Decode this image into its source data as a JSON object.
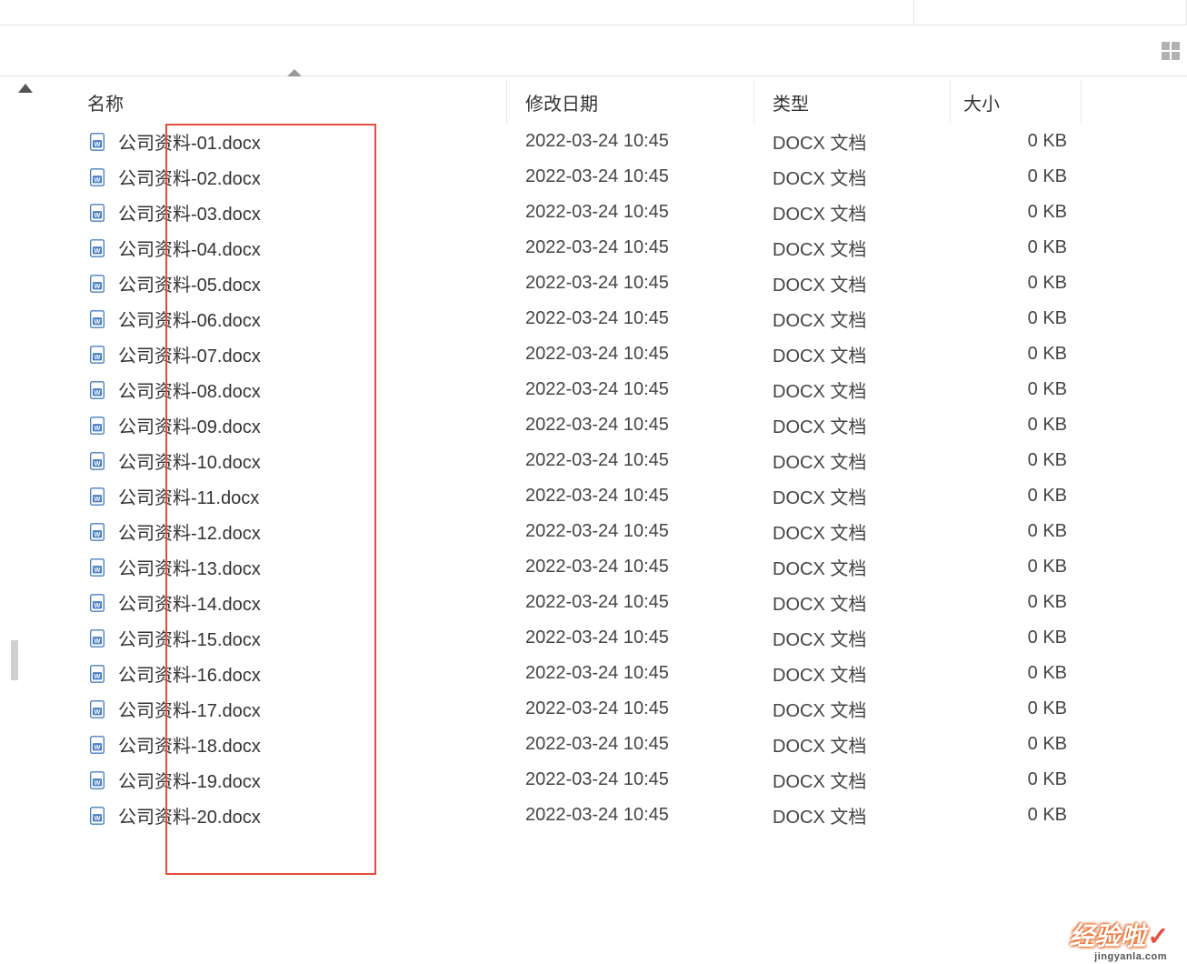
{
  "columns": {
    "name": "名称",
    "date": "修改日期",
    "type": "类型",
    "size": "大小"
  },
  "files": [
    {
      "name": "公司资料-01.docx",
      "date": "2022-03-24 10:45",
      "type": "DOCX 文档",
      "size": "0 KB"
    },
    {
      "name": "公司资料-02.docx",
      "date": "2022-03-24 10:45",
      "type": "DOCX 文档",
      "size": "0 KB"
    },
    {
      "name": "公司资料-03.docx",
      "date": "2022-03-24 10:45",
      "type": "DOCX 文档",
      "size": "0 KB"
    },
    {
      "name": "公司资料-04.docx",
      "date": "2022-03-24 10:45",
      "type": "DOCX 文档",
      "size": "0 KB"
    },
    {
      "name": "公司资料-05.docx",
      "date": "2022-03-24 10:45",
      "type": "DOCX 文档",
      "size": "0 KB"
    },
    {
      "name": "公司资料-06.docx",
      "date": "2022-03-24 10:45",
      "type": "DOCX 文档",
      "size": "0 KB"
    },
    {
      "name": "公司资料-07.docx",
      "date": "2022-03-24 10:45",
      "type": "DOCX 文档",
      "size": "0 KB"
    },
    {
      "name": "公司资料-08.docx",
      "date": "2022-03-24 10:45",
      "type": "DOCX 文档",
      "size": "0 KB"
    },
    {
      "name": "公司资料-09.docx",
      "date": "2022-03-24 10:45",
      "type": "DOCX 文档",
      "size": "0 KB"
    },
    {
      "name": "公司资料-10.docx",
      "date": "2022-03-24 10:45",
      "type": "DOCX 文档",
      "size": "0 KB"
    },
    {
      "name": "公司资料-11.docx",
      "date": "2022-03-24 10:45",
      "type": "DOCX 文档",
      "size": "0 KB"
    },
    {
      "name": "公司资料-12.docx",
      "date": "2022-03-24 10:45",
      "type": "DOCX 文档",
      "size": "0 KB"
    },
    {
      "name": "公司资料-13.docx",
      "date": "2022-03-24 10:45",
      "type": "DOCX 文档",
      "size": "0 KB"
    },
    {
      "name": "公司资料-14.docx",
      "date": "2022-03-24 10:45",
      "type": "DOCX 文档",
      "size": "0 KB"
    },
    {
      "name": "公司资料-15.docx",
      "date": "2022-03-24 10:45",
      "type": "DOCX 文档",
      "size": "0 KB"
    },
    {
      "name": "公司资料-16.docx",
      "date": "2022-03-24 10:45",
      "type": "DOCX 文档",
      "size": "0 KB"
    },
    {
      "name": "公司资料-17.docx",
      "date": "2022-03-24 10:45",
      "type": "DOCX 文档",
      "size": "0 KB"
    },
    {
      "name": "公司资料-18.docx",
      "date": "2022-03-24 10:45",
      "type": "DOCX 文档",
      "size": "0 KB"
    },
    {
      "name": "公司资料-19.docx",
      "date": "2022-03-24 10:45",
      "type": "DOCX 文档",
      "size": "0 KB"
    },
    {
      "name": "公司资料-20.docx",
      "date": "2022-03-24 10:45",
      "type": "DOCX 文档",
      "size": "0 KB"
    }
  ],
  "watermark": {
    "cn": "经验啦",
    "en": "jingyanla.com"
  }
}
